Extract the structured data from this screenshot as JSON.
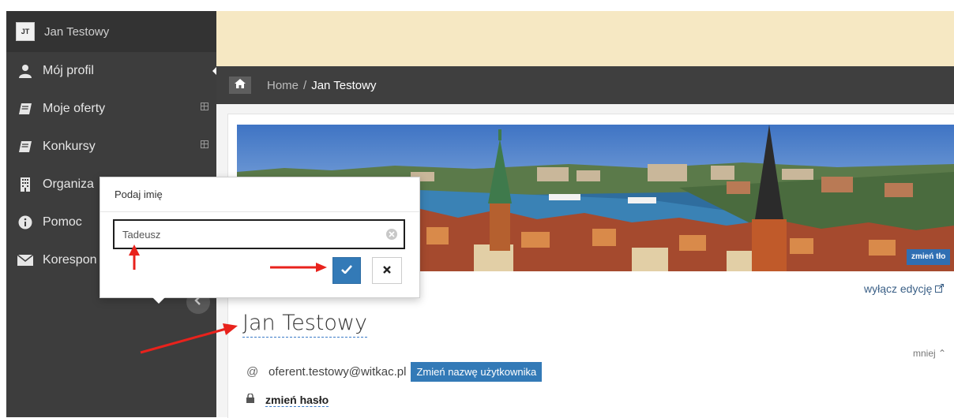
{
  "user": {
    "initials": "JT",
    "name": "Jan Testowy"
  },
  "sidebar": {
    "items": [
      {
        "label": "Mój profil",
        "icon": "user-icon"
      },
      {
        "label": "Moje oferty",
        "icon": "book-icon"
      },
      {
        "label": "Konkursy",
        "icon": "book-icon"
      },
      {
        "label": "Organiza",
        "icon": "building-icon"
      },
      {
        "label": "Pomoc",
        "icon": "info-icon"
      },
      {
        "label": "Korespon",
        "icon": "envelope-icon"
      }
    ]
  },
  "breadcrumb": {
    "home": "Home",
    "separator": "/",
    "current": "Jan Testowy"
  },
  "banner": {
    "change_bg_label": "zmień tło"
  },
  "profile": {
    "edit_toggle": "wyłącz edycję",
    "name": "Jan Testowy",
    "less_label": "mniej ⌃",
    "email_prefix": "@",
    "email": "oferent.testowy@witkac.pl",
    "change_username_label": "Zmień nazwę użytkownika",
    "change_password_label": "zmień hasło"
  },
  "popover": {
    "title": "Podaj imię",
    "input_value": "Tadeusz"
  },
  "colors": {
    "sidebar": "#3d3d3d",
    "topbar": "#f6e8c3",
    "primary": "#337ab7",
    "annotation": "#e8221c"
  }
}
